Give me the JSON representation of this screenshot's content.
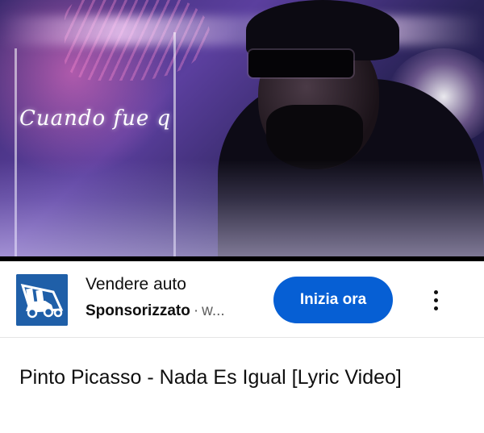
{
  "video": {
    "lyric_overlay": "Cuando fue q"
  },
  "ad": {
    "logo_icon": "car-tow-truck-icon",
    "title": "Vendere auto",
    "sponsored_label": "Sponsorizzato",
    "separator": "·",
    "domain": "w...",
    "cta_label": "Inizia ora",
    "more_icon": "more-vert-icon",
    "colors": {
      "logo_bg": "#1f5fa8",
      "cta_bg": "#065fd4"
    }
  },
  "video_title": "Pinto Picasso - Nada Es Igual [Lyric Video]"
}
